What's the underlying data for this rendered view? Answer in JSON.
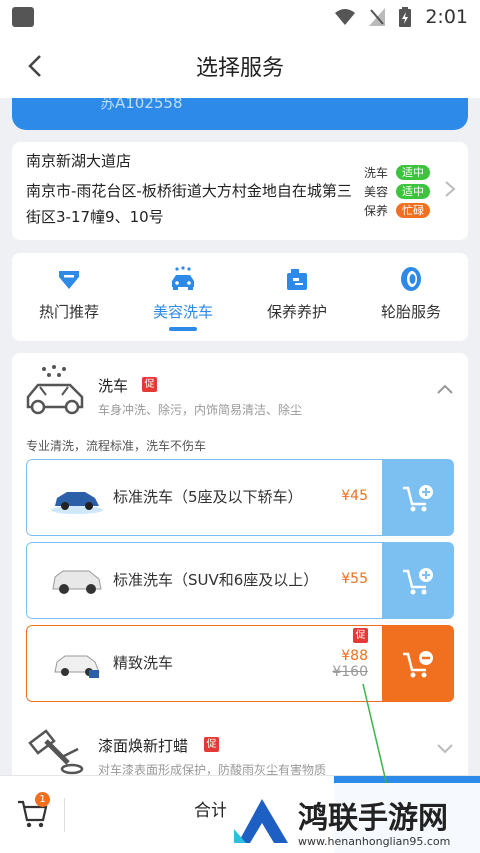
{
  "status_bar": {
    "time": "2:01"
  },
  "header": {
    "title": "选择服务"
  },
  "vehicle": {
    "plate": "苏A102558"
  },
  "store": {
    "name": "南京新湖大道店",
    "address": "南京市-雨花台区-板桥街道大方村金地自在城第三街区3-17幢9、10号",
    "status": [
      {
        "label": "洗车",
        "value": "适中",
        "color": "#3cc43c"
      },
      {
        "label": "美容",
        "value": "适中",
        "color": "#3cc43c"
      },
      {
        "label": "保养",
        "value": "忙碌",
        "color": "#f07020"
      }
    ]
  },
  "tabs": [
    {
      "label": "热门推荐",
      "icon": "diamond-icon"
    },
    {
      "label": "美容洗车",
      "icon": "car-wash-icon",
      "active": true
    },
    {
      "label": "保养养护",
      "icon": "oil-can-icon"
    },
    {
      "label": "轮胎服务",
      "icon": "tire-icon"
    }
  ],
  "category_wash": {
    "name": "洗车",
    "promo": "促",
    "desc": "车身冲洗、除污，内饰简易清洁、除尘",
    "hint": "专业清洗，流程标准，洗车不伤车"
  },
  "items": [
    {
      "name": "标准洗车（5座及以下轿车）",
      "price": "¥45",
      "selected": false
    },
    {
      "name": "标准洗车（SUV和6座及以上）",
      "price": "¥55",
      "selected": false
    },
    {
      "name": "精致洗车",
      "price": "¥88",
      "old_price": "¥160",
      "promo": "促",
      "selected": true
    }
  ],
  "category_paint": {
    "name": "漆面焕新打蜡",
    "promo": "促",
    "desc": "对车漆表面形成保护，防酸雨灰尘有害物质"
  },
  "bottom_bar": {
    "cart_count": "1",
    "total_label": "合计"
  },
  "watermark": {
    "title": "鸿联手游网",
    "url": "www.henanhonglian95.com"
  },
  "colors": {
    "accent": "#2d8ae8",
    "light_blue": "#7cc0f2",
    "orange": "#f07020",
    "promo_red": "#e53935"
  }
}
